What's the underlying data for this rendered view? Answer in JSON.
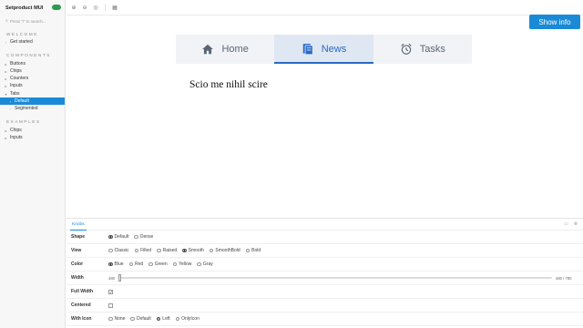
{
  "sidebar": {
    "brand": "Setproduct MUI",
    "search_placeholder": "Press \"/\" to search...",
    "sections": [
      {
        "title": "WELCOME"
      },
      {
        "title": "COMPONENTS"
      },
      {
        "title": "EXAMPLES"
      }
    ],
    "items": [
      {
        "label": "Get started"
      },
      {
        "label": "Buttons"
      },
      {
        "label": "Chips"
      },
      {
        "label": "Counters"
      },
      {
        "label": "Inputs"
      },
      {
        "label": "Tabs"
      },
      {
        "label": "Default"
      },
      {
        "label": "Segmented"
      },
      {
        "label": "Chips"
      },
      {
        "label": "Inputs"
      }
    ]
  },
  "canvas": {
    "show_info": "Show info",
    "tabs": [
      {
        "label": "Home",
        "icon": "home-icon"
      },
      {
        "label": "News",
        "icon": "news-icon"
      },
      {
        "label": "Tasks",
        "icon": "alarm-clock-icon"
      }
    ],
    "selected_tab": "News",
    "content_text": "Scio me nihil scire",
    "accent": "#2a69c4"
  },
  "panel": {
    "tab_label": "Knobs",
    "rows": {
      "shape": {
        "label": "Shape",
        "options": [
          "Default",
          "Dense"
        ],
        "selected": "Default"
      },
      "view": {
        "label": "View",
        "options": [
          "Classic",
          "Filled",
          "Raised",
          "Smooth",
          "SmoothBold",
          "Bold"
        ],
        "selected": "Smooth"
      },
      "color": {
        "label": "Color",
        "options": [
          "Blue",
          "Red",
          "Green",
          "Yellow",
          "Gray"
        ],
        "selected": "Blue"
      },
      "width": {
        "label": "Width",
        "min_label": "480",
        "value_label": "480 / 780",
        "value_fraction": 0.0
      },
      "full_width": {
        "label": "Full Width",
        "checked": true
      },
      "centered": {
        "label": "Centered",
        "checked": false
      },
      "with_icon": {
        "label": "With Icon",
        "options": [
          "None",
          "Default",
          "Left",
          "OnlyIcon"
        ],
        "selected": "Left"
      }
    }
  }
}
